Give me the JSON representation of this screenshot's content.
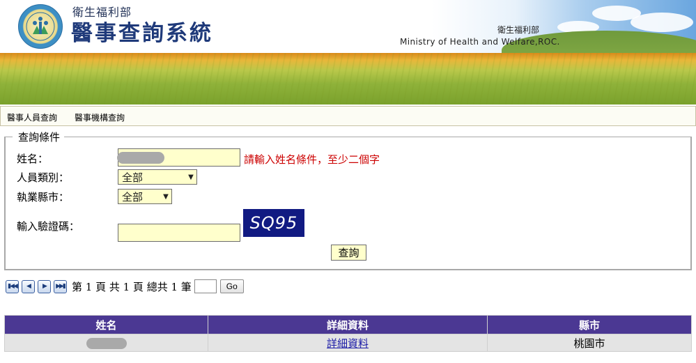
{
  "header": {
    "ministry_small": "衛生福利部",
    "system_title": "醫事查詢系統",
    "ministry_cn": "衛生福利部",
    "ministry_en": "Ministry of Health and Welfare,ROC."
  },
  "nav": {
    "items": [
      {
        "label": "醫事人員查詢"
      },
      {
        "label": "醫事機構查詢"
      }
    ]
  },
  "query": {
    "legend": "查詢條件",
    "name_label": "姓名：",
    "name_value": "",
    "name_hint": "請輸入姓名條件，至少二個字",
    "type_label": "人員類別：",
    "type_selected": "全部",
    "city_label": "執業縣市：",
    "city_selected": "全部",
    "captcha_label": "輸入驗證碼：",
    "captcha_text": "SQ95",
    "captcha_value": "",
    "search_label": "查詢"
  },
  "pager": {
    "text": "第 1 頁 共 1 頁 總共 1 筆",
    "go_label": "Go",
    "icons": [
      "first-page-icon",
      "prev-page-icon",
      "next-page-icon",
      "last-page-icon"
    ]
  },
  "results": {
    "headers": [
      "姓名",
      "詳細資料",
      "縣市"
    ],
    "rows": [
      {
        "name": "",
        "detail": "詳細資料",
        "city": "桃園市"
      }
    ]
  },
  "colors": {
    "table_header": "#4b3893",
    "input_background": "#ffffcc",
    "hint_text": "#cc0000",
    "captcha_background": "#111a82"
  }
}
